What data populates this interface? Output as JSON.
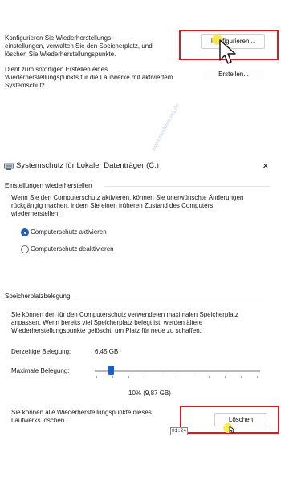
{
  "top_panel": {
    "configure_text": "Konfigurieren Sie Wiederherstellungs-\neinstellungen, verwalten Sie den Speicherplatz, und\nlöschen Sie Wiederherstellungspunkte.",
    "create_text": "Dient zum sofortigen Erstellen eines\nWiederherstellungspunkts für die Laufwerke mit aktiviertem\nSystemschutz.",
    "configure_button": "Konfigurieren...",
    "create_button": "Erstellen..."
  },
  "watermark": "www.windows-faq.de",
  "dialog": {
    "title": "Systemschutz für Lokaler Datenträger (C:)",
    "close_glyph": "×",
    "restore_settings": {
      "heading": "Einstellungen wiederherstellen",
      "description": "Wenn Sie den Computerschutz aktivieren, können Sie unerwünschte Änderungen\nrückgängig machen, indem Sie einen früheren Zustand des Computers\nwiederherstellen.",
      "option_on": "Computerschutz aktivieren",
      "option_off": "Computerschutz deaktivieren",
      "selected": "on"
    },
    "disk_usage": {
      "heading": "Speicherplatzbelegung",
      "description": "Sie können den für den Computerschutz verwendeten maximalen Speicherplatz\nanpassen. Wenn bereits viel Speicherplatz belegt ist, werden ältere\nWiederherstellungspunkte gelöscht, um Platz für neue zu schaffen.",
      "current_label": "Derzeitige Belegung:",
      "current_value": "6,45 GB",
      "max_label": "Maximale Belegung:",
      "max_value": "10% (9,87 GB)",
      "slider_fraction": 0.1
    },
    "delete_text": "Sie können alle Wiederherstellungspunkte dieses\nLaufwerks löschen.",
    "delete_button": "Löschen",
    "timestamp": "01:24"
  },
  "colors": {
    "highlight": "#e8141b",
    "accent": "#1960d6",
    "cursor_marker": "#f6e94a"
  }
}
